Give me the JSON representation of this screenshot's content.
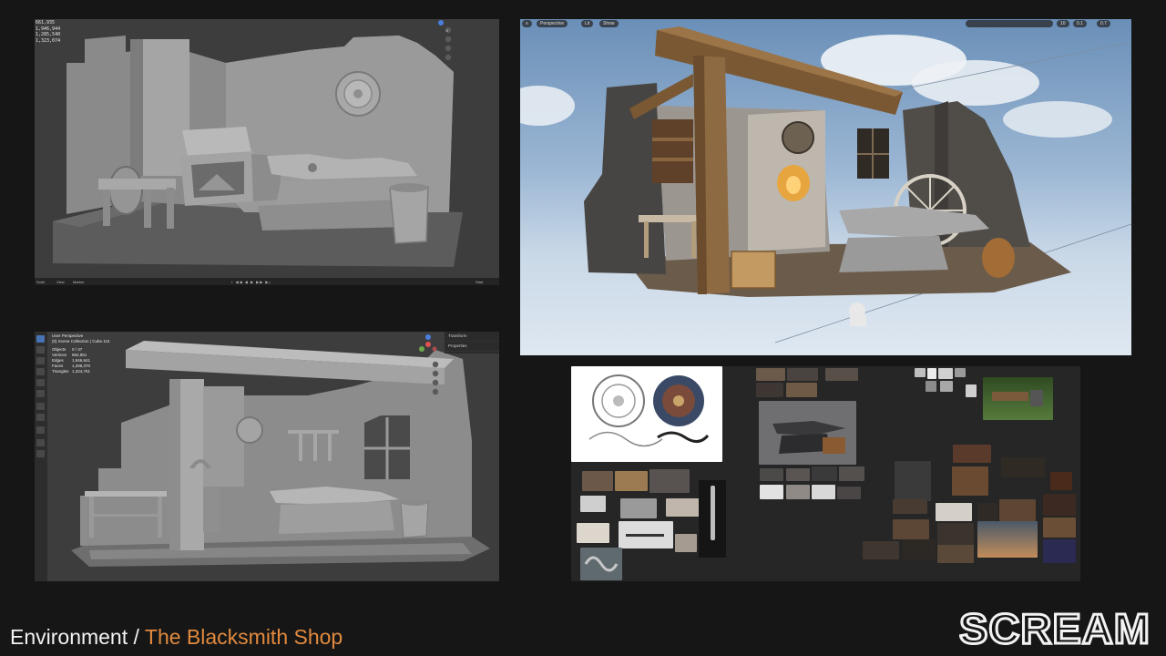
{
  "colors": {
    "accent": "#e28a3e",
    "background": "#161616",
    "text": "#f2f2f2"
  },
  "blender_top": {
    "stats": [
      "661,935",
      "1,946,944",
      "1,285,540",
      "1,323,074"
    ],
    "footer": {
      "mode": "Solid",
      "view": "View",
      "marker": "Marker",
      "playback": "Start"
    },
    "icons": [
      "axis-gizmo-icon",
      "zoom-icon",
      "hand-pan-icon",
      "camera-icon",
      "grid-icon"
    ]
  },
  "unreal": {
    "toolbar": {
      "menu": "≡",
      "view_mode": "Perspective",
      "lit": "Lit",
      "show": "Show"
    },
    "right_values": [
      "10",
      "0.1",
      "0.7"
    ]
  },
  "blender_bottom": {
    "view_name": "User Perspective",
    "collection": "(0) Scene Collection | Cube.115",
    "stats": [
      {
        "label": "Objects",
        "value": "0 / 37"
      },
      {
        "label": "Vertices",
        "value": "662,851"
      },
      {
        "label": "Edges",
        "value": "1,946,641"
      },
      {
        "label": "Faces",
        "value": "1,288,370"
      },
      {
        "label": "Triangles",
        "value": "1,324,751"
      }
    ],
    "side_panel": [
      "Transform",
      "Properties"
    ]
  },
  "caption": {
    "prefix": "Environment /",
    "title": "The Blacksmith Shop"
  },
  "logo": {
    "text": "SCREAM"
  }
}
